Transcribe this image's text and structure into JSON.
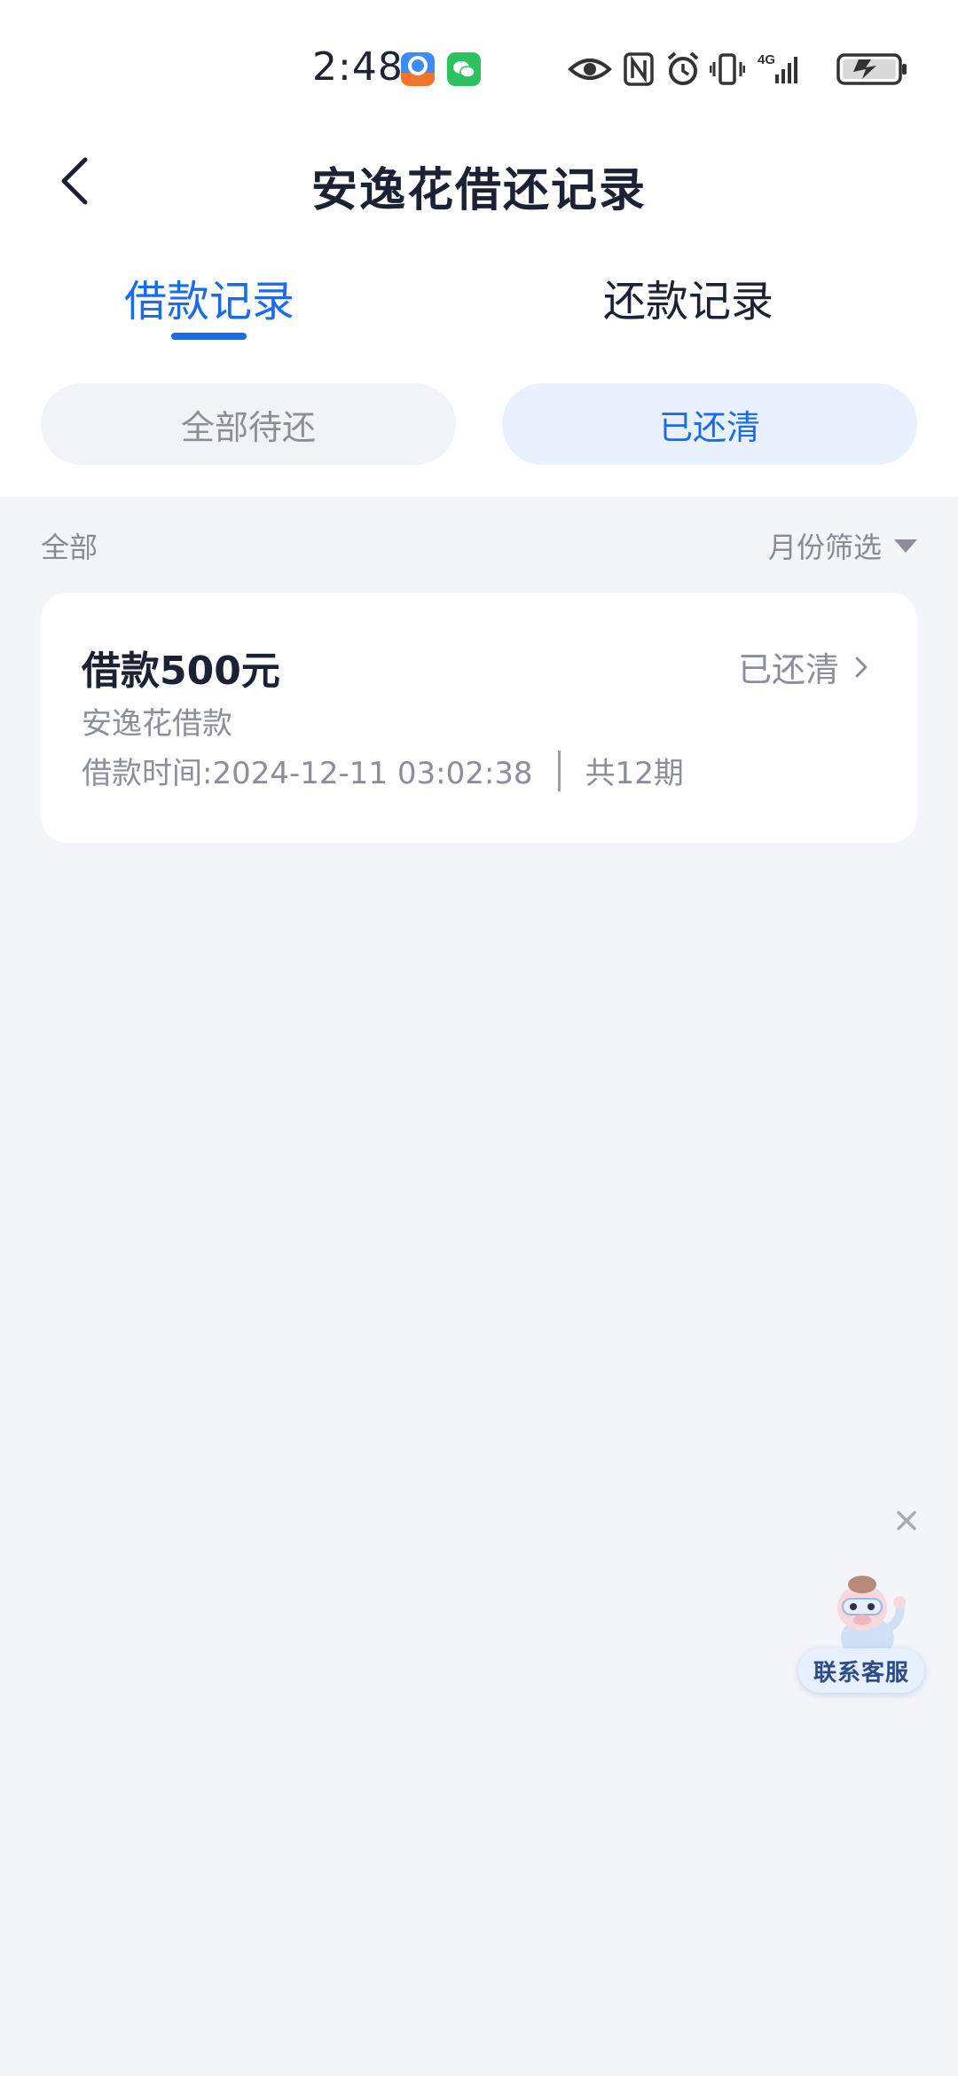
{
  "status_bar": {
    "time": "2:48",
    "app_icons": [
      "notification-app-icon",
      "wechat-icon"
    ],
    "right_icons": [
      "eye-icon",
      "nfc-icon",
      "alarm-icon",
      "vibrate-icon",
      "signal-4g-icon",
      "battery-icon"
    ],
    "network": "4G"
  },
  "header": {
    "title": "安逸花借还记录"
  },
  "tabs": [
    {
      "label": "借款记录",
      "active": true
    },
    {
      "label": "还款记录",
      "active": false
    }
  ],
  "filters": [
    {
      "label": "全部待还",
      "selected": false
    },
    {
      "label": "已还清",
      "selected": true
    }
  ],
  "list_header": {
    "scope": "全部",
    "month_filter": "月份筛选"
  },
  "records": [
    {
      "amount": "借款500元",
      "status": "已还清",
      "product": "安逸花借款",
      "time": "借款时间:2024-12-11 03:02:38",
      "periods": "共12期"
    }
  ],
  "floating_service": {
    "label": "联系客服"
  },
  "colors": {
    "accent": "#1a6ce8",
    "background": "#f3f5f8",
    "text_primary": "#1b2233",
    "text_secondary": "#8a8f99"
  }
}
